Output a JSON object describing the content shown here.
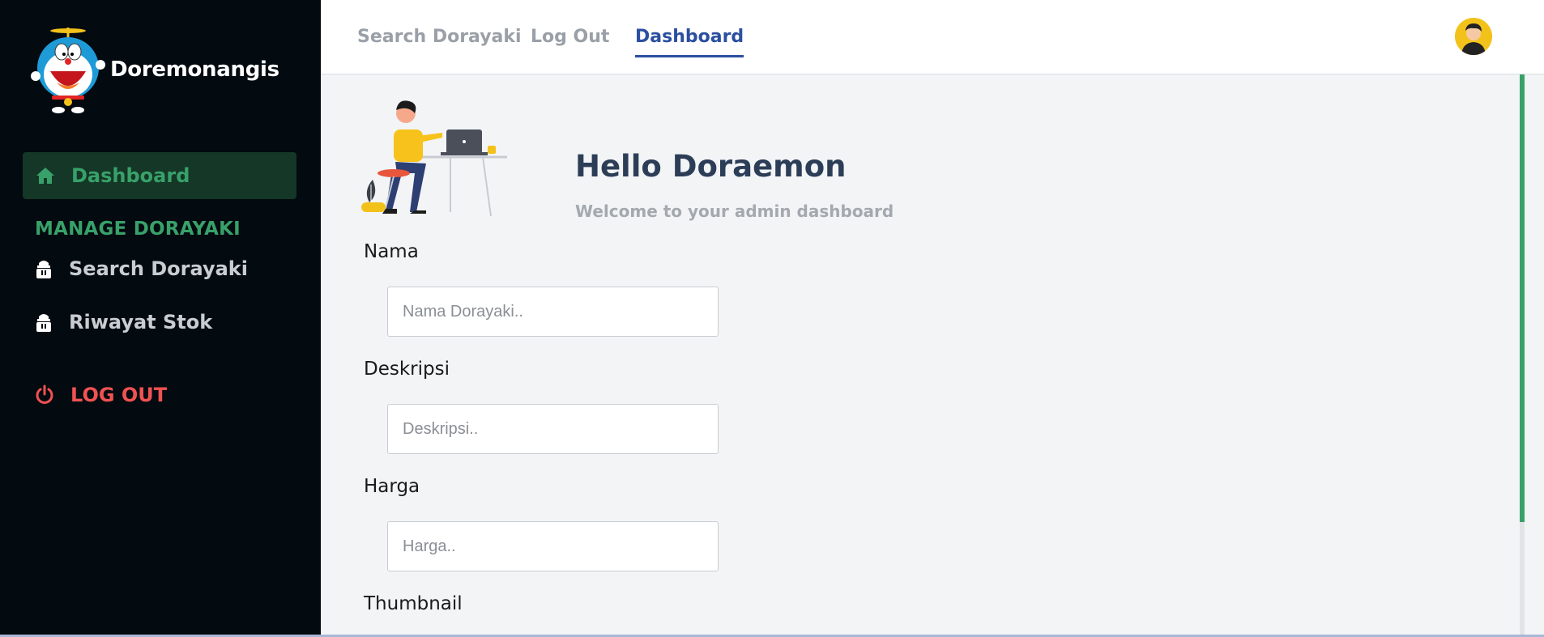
{
  "brand": {
    "name": "Doremonangis",
    "logo_icon": "doraemon-logo"
  },
  "sidebar": {
    "active": {
      "label": "Dashboard",
      "icon": "home-icon"
    },
    "section_title": "MANAGE DORAYAKI",
    "items": [
      {
        "label": "Search Dorayaki",
        "icon": "dorayaki-icon"
      },
      {
        "label": "Riwayat Stok",
        "icon": "dorayaki-icon"
      }
    ],
    "logout": {
      "label": "LOG OUT",
      "icon": "power-icon"
    }
  },
  "topbar": {
    "tabs": [
      {
        "label": "Search Dorayaki"
      },
      {
        "label": "Log Out"
      },
      {
        "label": "Dashboard",
        "active": true
      }
    ],
    "avatar_icon": "user-avatar"
  },
  "hero": {
    "greeting": "Hello Doraemon",
    "subtitle": "Welcome to your admin dashboard"
  },
  "form": {
    "nama": {
      "label": "Nama",
      "placeholder": "Nama Dorayaki..",
      "value": ""
    },
    "deskripsi": {
      "label": "Deskripsi",
      "placeholder": "Deskripsi..",
      "value": ""
    },
    "harga": {
      "label": "Harga",
      "placeholder": "Harga..",
      "value": ""
    },
    "thumbnail": {
      "label": "Thumbnail"
    }
  },
  "colors": {
    "sidebar_bg": "#030a10",
    "accent_green": "#38a169",
    "active_bg": "#143727",
    "logout_red": "#f05252",
    "tab_active": "#2b4fa0",
    "heading": "#2c3e57"
  }
}
